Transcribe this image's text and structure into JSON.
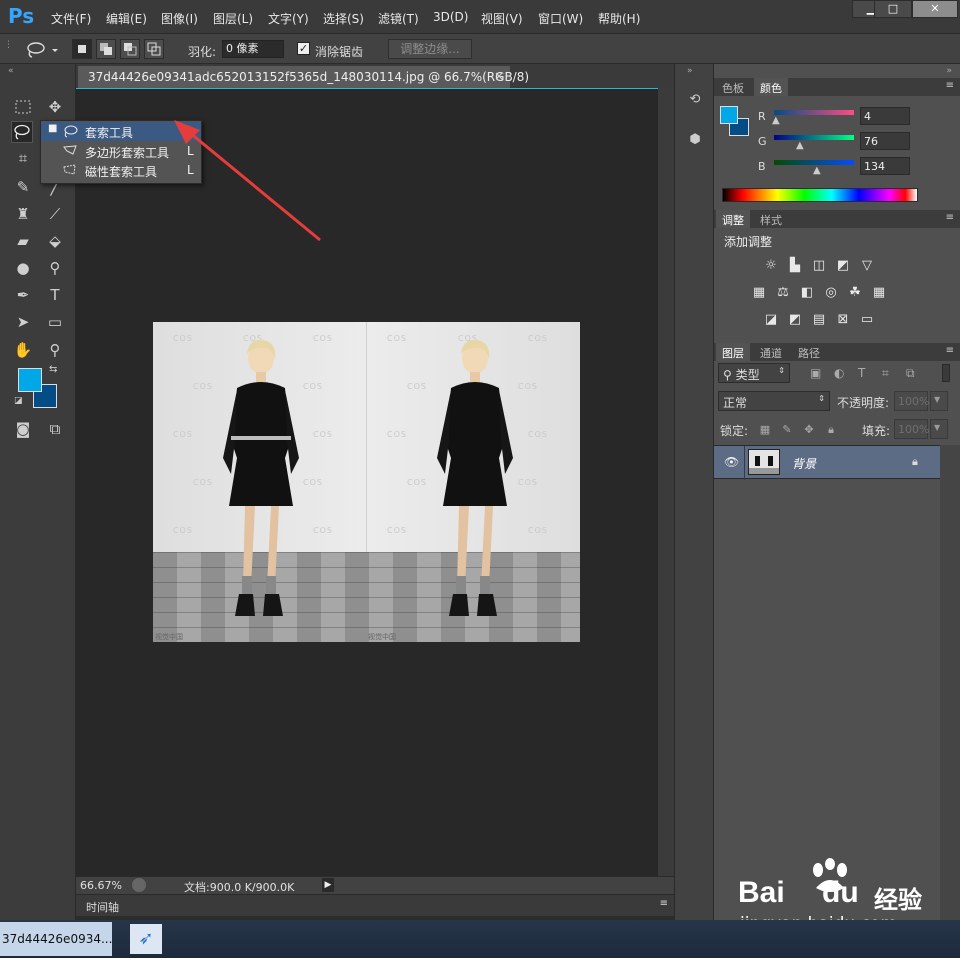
{
  "menubar": {
    "logo": "Ps",
    "items": [
      "文件(F)",
      "编辑(E)",
      "图像(I)",
      "图层(L)",
      "文字(Y)",
      "选择(S)",
      "滤镜(T)",
      "3D(D)",
      "视图(V)",
      "窗口(W)",
      "帮助(H)"
    ],
    "min": "▁",
    "max": "□",
    "close": "✕"
  },
  "options": {
    "feather_label": "羽化:",
    "feather_value": "0 像素",
    "antialias_label": "消除锯齿",
    "refine_edge": "调整边缘..."
  },
  "document": {
    "tab_title": "37d44426e09341adc652013152f5365d_148030114.jpg @ 66.7%(RGB/8)",
    "tab_close": "×",
    "zoom": "66.67%",
    "doc_size": "文档:900.0 K/900.0K",
    "timeline_label": "时间轴"
  },
  "photo": {
    "watermark": "COS",
    "credit": "视觉中国"
  },
  "flyout": {
    "items": [
      {
        "label": "套索工具",
        "key": "L"
      },
      {
        "label": "多边形套索工具",
        "key": "L"
      },
      {
        "label": "磁性套索工具",
        "key": "L"
      }
    ]
  },
  "color_panel": {
    "tabs": [
      "色板",
      "颜色"
    ],
    "r_label": "R",
    "r_value": "4",
    "g_label": "G",
    "g_value": "76",
    "b_label": "B",
    "b_value": "134",
    "fg_color": "#044c86"
  },
  "adjust_panel": {
    "tabs": [
      "调整",
      "样式"
    ],
    "title": "添加调整"
  },
  "layers_panel": {
    "tabs": [
      "图层",
      "通道",
      "路径"
    ],
    "filter_kind": "类型",
    "blend_mode": "正常",
    "opacity_label": "不透明度:",
    "opacity_value": "100%",
    "lock_label": "锁定:",
    "fill_label": "填充:",
    "fill_value": "100%",
    "layer_name": "背景"
  },
  "taskbar": {
    "item": "37d44426e0934..."
  },
  "watermark": {
    "brand": "Bai",
    "brand2": "du",
    "jingyan": "经验",
    "url": "jingyan.baidu.com"
  },
  "colors": {
    "accent": "#2bb6d4",
    "selection": "#3b5a83",
    "fg_swatch": "#00a8e8",
    "bg_swatch": "#044c86",
    "arrow": "#e63c3c"
  }
}
